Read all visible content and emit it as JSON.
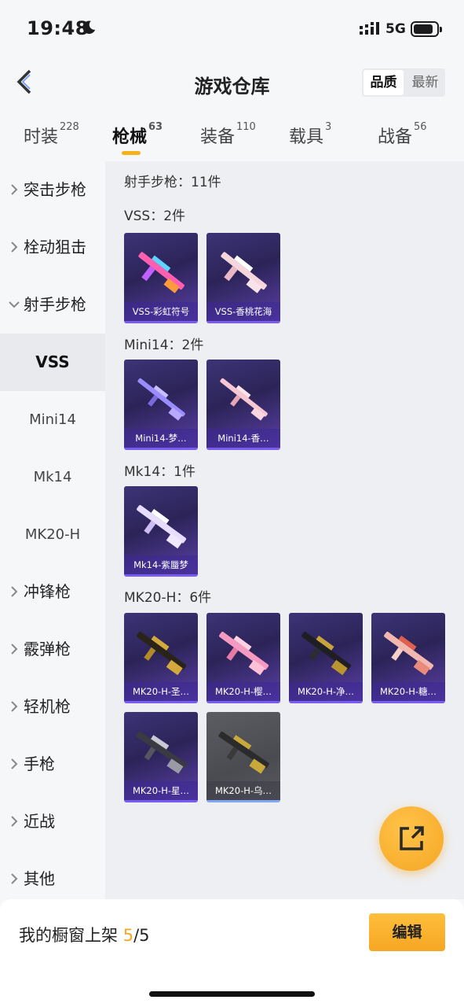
{
  "status": {
    "time": "19:48",
    "network": "5G"
  },
  "header": {
    "title": "游戏仓库",
    "sort_options": [
      "品质",
      "最新"
    ],
    "sort_active": "品质"
  },
  "tabs": [
    {
      "label": "时装",
      "count": "228"
    },
    {
      "label": "枪械",
      "count": "63"
    },
    {
      "label": "装备",
      "count": "110"
    },
    {
      "label": "载具",
      "count": "3"
    },
    {
      "label": "战备",
      "count": "56"
    }
  ],
  "sidebar": {
    "categories": [
      "突击步枪",
      "栓动狙击",
      "射手步枪"
    ],
    "subcategories": [
      "VSS",
      "Mini14",
      "Mk14",
      "MK20-H"
    ],
    "more_categories": [
      "冲锋枪",
      "霰弹枪",
      "轻机枪",
      "手枪",
      "近战",
      "其他"
    ]
  },
  "content": {
    "summary": "射手步枪：11件",
    "groups": [
      {
        "title": "VSS：2件",
        "items": [
          "VSS-彩虹符号",
          "VSS-香桃花海"
        ]
      },
      {
        "title": "Mini14：2件",
        "items": [
          "Mini14-梦…",
          "Mini14-香…"
        ]
      },
      {
        "title": "Mk14：1件",
        "items": [
          "Mk14-紫蜃梦"
        ]
      },
      {
        "title": "MK20-H：6件",
        "items": [
          "MK20-H-圣…",
          "MK20-H-樱…",
          "MK20-H-净…",
          "MK20-H-糖…",
          "MK20-H-星…",
          "MK20-H-乌…"
        ]
      }
    ]
  },
  "bottom": {
    "shelf_label": "我的橱窗上架",
    "shelf_current": "5",
    "shelf_total": "/5",
    "edit_label": "编辑"
  },
  "colors": {
    "accent": "#f5a623",
    "card_purple": "#2c2458",
    "card_gray": "#4a4b51"
  },
  "icons": {
    "back": "chevron-left-icon",
    "share": "external-link-icon",
    "moon": "moon-icon"
  }
}
